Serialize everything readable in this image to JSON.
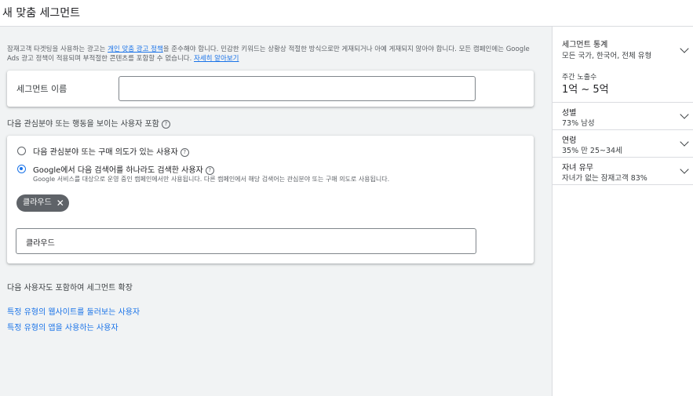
{
  "page": {
    "title": "새 맞춤 세그먼트"
  },
  "notice": {
    "text_before": "잠재고객 타겟팅을 사용하는 광고는 ",
    "policy_link": "개인 맞춤 광고 정책",
    "text_after": "을 준수해야 합니다. 민감한 키워드는 상황상 적절한 방식으로만 게재되거나 아예 게재되지 않아야 합니다. 모든 캠페인에는 Google Ads 광고 정책이 적용되며 부적절한 콘텐츠를 포함할 수 없습니다. ",
    "learn_more": "자세히 알아보기"
  },
  "segment_name": {
    "label": "세그먼트 이름",
    "value": ""
  },
  "include_label": "다음 관심분야 또는 행동을 보이는 사용자 포함",
  "options": [
    {
      "label": "다음 관심분야 또는 구매 의도가 있는 사용자",
      "selected": false
    },
    {
      "label": "Google에서 다음 검색어를 하나라도 검색한 사용자",
      "selected": true,
      "sub": "Google 서비스를 대상으로 운영 중인 캠페인에서만 사용됩니다. 다른 캠페인에서 해당 검색어는 관심분야 또는 구매 의도로 사용됩니다."
    }
  ],
  "keyword_chip": "클라우드",
  "keyword_input": "클라우드",
  "expand_label": "다음 사용자도 포함하여 세그먼트 확장",
  "expand_links": [
    "특정 유형의 웹사이트를 둘러보는 사용자",
    "특정 유형의 앱을 사용하는 사용자"
  ],
  "sidebar": {
    "stats_title": "세그먼트 통계",
    "stats_value": "모든 국가, 한국어, 전체 유형",
    "reach_title": "주간 노출수",
    "reach_value": "1억 ~ 5억",
    "sections": [
      {
        "title": "성별",
        "value": "73% 남성"
      },
      {
        "title": "연령",
        "value": "35% 만 25~34세"
      },
      {
        "title": "자녀 유무",
        "value": "자녀가 없는 잠재고객 83%"
      }
    ]
  }
}
